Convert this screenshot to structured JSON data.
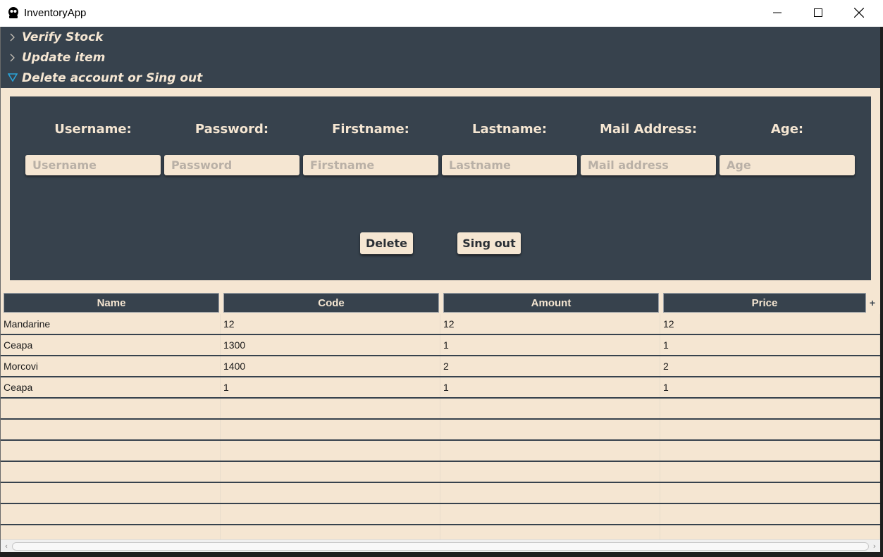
{
  "window": {
    "title": "InventoryApp",
    "minimize_icon": "minimize-icon",
    "maximize_icon": "maximize-icon",
    "close_icon": "close-icon"
  },
  "accordion": {
    "items": [
      {
        "label": "Verify Stock",
        "expanded": false
      },
      {
        "label": "Update item",
        "expanded": false
      },
      {
        "label": "Delete account or Sing out",
        "expanded": true
      }
    ]
  },
  "form": {
    "fields": [
      {
        "label": "Username:",
        "placeholder": "Username",
        "value": ""
      },
      {
        "label": "Password:",
        "placeholder": "Password",
        "value": ""
      },
      {
        "label": "Firstname:",
        "placeholder": "Firstname",
        "value": ""
      },
      {
        "label": "Lastname:",
        "placeholder": "Lastname",
        "value": ""
      },
      {
        "label": "Mail Address:",
        "placeholder": "Mail address",
        "value": ""
      },
      {
        "label": "Age:",
        "placeholder": "Age",
        "value": ""
      }
    ],
    "delete_label": "Delete",
    "signout_label": "Sing out"
  },
  "table": {
    "columns": [
      "Name",
      "Code",
      "Amount",
      "Price"
    ],
    "column_menu": "+",
    "rows": [
      [
        "Mandarine",
        "12",
        "12",
        "12"
      ],
      [
        "Ceapa",
        "1300",
        "1",
        "1"
      ],
      [
        "Morcovi",
        "1400",
        "2",
        "2"
      ],
      [
        "Ceapa",
        "1",
        "1",
        "1"
      ]
    ]
  },
  "colors": {
    "panel_dark": "#37424d",
    "cream": "#f5e6d2",
    "accent_arrow": "#2aa3d8"
  }
}
